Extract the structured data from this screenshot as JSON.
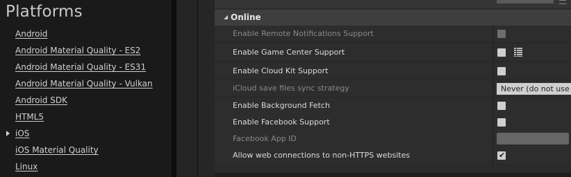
{
  "sidebar": {
    "title": "Platforms",
    "items": [
      {
        "label": "Android"
      },
      {
        "label": "Android Material Quality - ES2"
      },
      {
        "label": "Android Material Quality - ES31"
      },
      {
        "label": "Android Material Quality - Vulkan"
      },
      {
        "label": "Android SDK"
      },
      {
        "label": "HTML5"
      },
      {
        "label": "iOS",
        "selected": true
      },
      {
        "label": "iOS Material Quality"
      },
      {
        "label": "Linux"
      }
    ]
  },
  "panel": {
    "category": "Online",
    "rows": [
      {
        "label": "Enable Remote Notifications Support",
        "control": "checkbox",
        "checked": false,
        "disabled": true
      },
      {
        "label": "Enable Game Center Support",
        "control": "checkbox",
        "checked": false,
        "disabled": false
      },
      {
        "label": "Enable Cloud Kit Support",
        "control": "checkbox",
        "checked": false,
        "disabled": false
      },
      {
        "label": "iCloud save files sync strategy",
        "control": "combo",
        "value": "Never (do not use iCloud for Load/Save Game)",
        "disabled": true
      },
      {
        "label": "Enable Background Fetch",
        "control": "checkbox",
        "checked": false,
        "disabled": false
      },
      {
        "label": "Enable Facebook Support",
        "control": "checkbox",
        "checked": false,
        "disabled": false
      },
      {
        "label": "Facebook App ID",
        "control": "textbox",
        "value": "",
        "disabled": true
      },
      {
        "label": "Allow web connections to non-HTTPS websites",
        "control": "checkbox",
        "checked": true,
        "disabled": false
      }
    ],
    "check_glyph": "✔",
    "grid_icon": "details-grid-icon"
  },
  "colors": {
    "sidebar_bg": "#1a1a1a",
    "panel_bg": "#2b2b2b",
    "category_bg": "#3e3e3e",
    "checkbox": "#cfcfcf"
  }
}
